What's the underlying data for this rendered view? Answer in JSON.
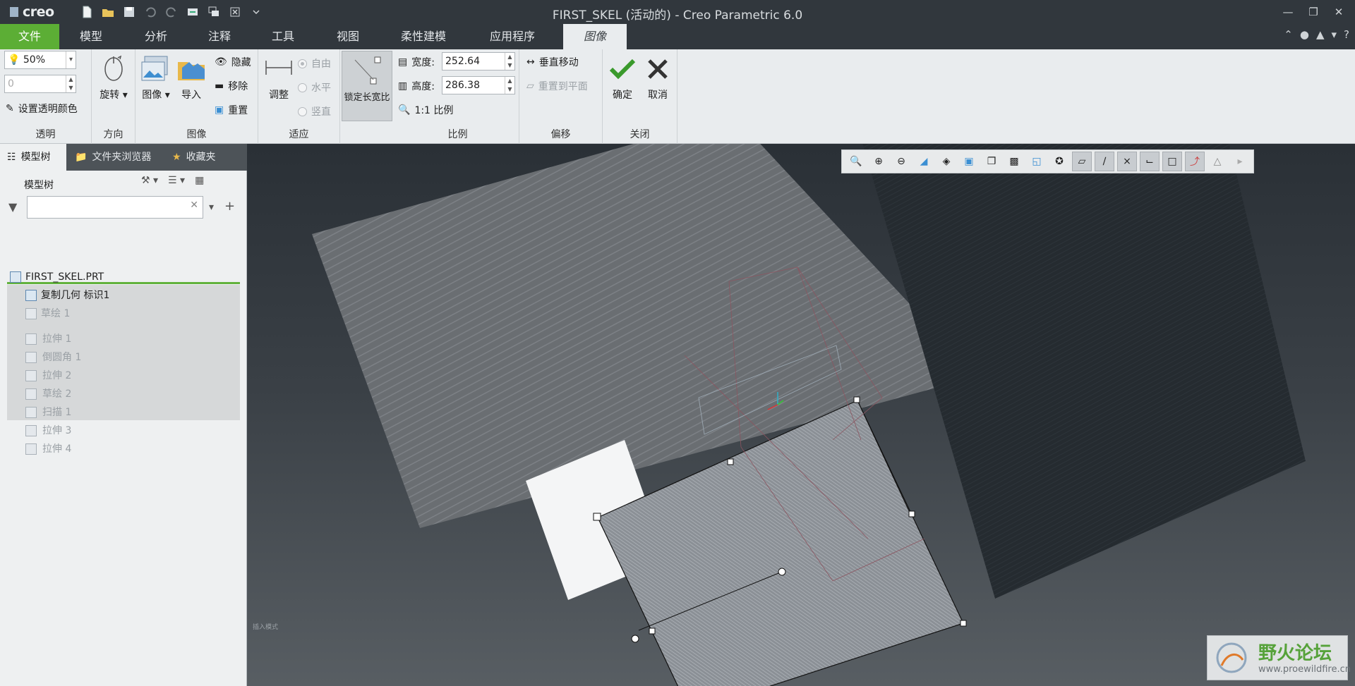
{
  "app": {
    "logo": "creo",
    "title": "FIRST_SKEL (活动的) - Creo Parametric 6.0"
  },
  "tabs": [
    {
      "label": "文件"
    },
    {
      "label": "模型"
    },
    {
      "label": "分析"
    },
    {
      "label": "注释"
    },
    {
      "label": "工具"
    },
    {
      "label": "视图"
    },
    {
      "label": "柔性建模"
    },
    {
      "label": "应用程序"
    },
    {
      "label": "图像"
    }
  ],
  "ribbon": {
    "transparency": {
      "group": "透明",
      "value": "50%",
      "second_value": "0",
      "set_color": "设置透明颜色"
    },
    "direction": {
      "group": "方向",
      "rotate": "旋转"
    },
    "image": {
      "group": "图像",
      "image_btn": "图像",
      "import": "导入",
      "hide": "隐藏",
      "remove": "移除",
      "reset": "重置"
    },
    "fit": {
      "group": "适应",
      "adjust": "调整",
      "free": "自由",
      "horizontal": "水平",
      "vertical": "竖直",
      "lock_aspect": "锁定长宽比"
    },
    "scale": {
      "group": "比例",
      "width_label": "宽度:",
      "width_value": "252.64",
      "height_label": "高度:",
      "height_value": "286.38",
      "one_to_one": "1:1 比例"
    },
    "offset": {
      "group": "偏移",
      "vertical_move": "垂直移动",
      "reset_plane": "重置到平面"
    },
    "close": {
      "group": "关闭",
      "ok": "确定",
      "cancel": "取消"
    }
  },
  "left_panel": {
    "nav_tabs": [
      "模型树",
      "文件夹浏览器",
      "收藏夹"
    ],
    "tree_title": "模型树",
    "filter_placeholder": "",
    "items": [
      {
        "label": "FIRST_SKEL.PRT",
        "state": "normal",
        "icon": "part-icon"
      },
      {
        "label": "复制几何 标识1",
        "state": "normal",
        "icon": "copy-geometry-icon"
      },
      {
        "label": "草绘 1",
        "state": "disabled",
        "icon": "sketch-icon"
      },
      {
        "label": "拉伸 1",
        "state": "suppressed",
        "icon": "extrude-icon"
      },
      {
        "label": "倒圆角 1",
        "state": "suppressed",
        "icon": "round-icon"
      },
      {
        "label": "拉伸 2",
        "state": "suppressed",
        "icon": "extrude-icon"
      },
      {
        "label": "草绘 2",
        "state": "suppressed",
        "icon": "sketch-icon"
      },
      {
        "label": "扫描 1",
        "state": "suppressed",
        "icon": "sweep-icon"
      },
      {
        "label": "拉伸 3",
        "state": "suppressed",
        "icon": "extrude-icon"
      },
      {
        "label": "拉伸 4",
        "state": "suppressed",
        "icon": "extrude-icon"
      }
    ]
  },
  "graphics": {
    "corner_label": "插入模式",
    "watermark_cn": "野火论坛",
    "watermark_url": "www.proewildfire.cn"
  },
  "colors": {
    "accent_green": "#5cae35",
    "titlebar": "#31373d",
    "ribbon": "#e9ecee"
  }
}
